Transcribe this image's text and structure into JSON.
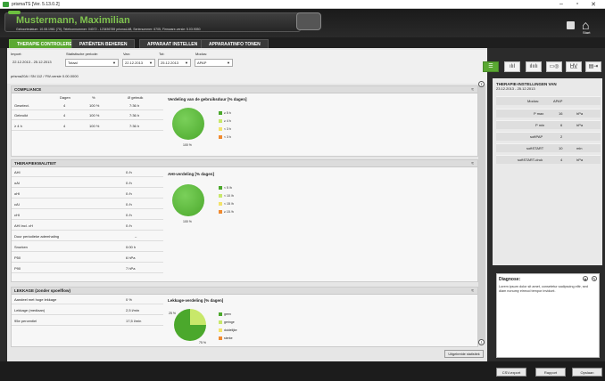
{
  "window": {
    "title": "prismaTS [Ver. 5.13.0.2]",
    "controls": [
      "–",
      "▫",
      "✕"
    ]
  },
  "patient": {
    "tag": "Meldung",
    "name": "Mustermann, Maximilian",
    "info": "Geboortedatum: 10.08.1961 (70), Telefoonnummer: 04072 - 123456789      prismaLAB, Serienummer: 6705, Firmware-versie: 5.03.9050"
  },
  "header": {
    "home_label": "Start"
  },
  "tabs": [
    "THERAPIE CONTROLEREN",
    "PATIËNTEN BEHEREN",
    "APPARAAT INSTELLEN",
    "APPARAATINFO TONEN"
  ],
  "filters": {
    "import_label": "Import:",
    "import_value": "22.12.2013 - 25.12.2013",
    "period_label": "Statistische periode:",
    "period_value": "Totaal",
    "from_label": "Van:",
    "from_value": "22.12.2013",
    "to_label": "Tot:",
    "to_value": "25.12.2013",
    "mode_label": "Modus:",
    "mode_value": "APAP",
    "fw": "prisma20A / SN 112 / FW-versie 0.00.0000"
  },
  "view_buttons": [
    "☰",
    "ılıl",
    "ılıılı",
    "▭◎",
    "H̲V̲",
    "▤⇥"
  ],
  "compliance": {
    "title": "COMPLIANCE",
    "headers": [
      "Dagen",
      "%",
      "Ø gebruik"
    ],
    "rows": [
      [
        "Geselect.",
        "4",
        "100 %",
        "7:36 h"
      ],
      [
        "Gebruikt",
        "4",
        "100 %",
        "7:36 h"
      ],
      [
        "≥ 4 h",
        "4",
        "100 %",
        "7:36 h"
      ]
    ],
    "chart_title": "Verdeling van de gebruiksduur [% dagen]",
    "pie_label": "100 %",
    "legend": [
      "≥ 5 h",
      "≥ 4 h",
      "< 3 h",
      "< 3 h"
    ]
  },
  "quality": {
    "title": "THERAPIEKWALITEIT",
    "rows": [
      [
        "AHI",
        "0 /h"
      ],
      [
        "oAI",
        "0 /h"
      ],
      [
        "oHI",
        "0 /h"
      ],
      [
        "cAI",
        "0 /h"
      ],
      [
        "cHI",
        "0 /h"
      ],
      [
        "AHI incl. cH",
        "0 /h"
      ],
      [
        "Duur periodieke ademhaling",
        "–"
      ],
      [
        "Snurken",
        "0:00 h"
      ],
      [
        "P50",
        "6 hPa"
      ],
      [
        "P90",
        "7 hPa"
      ]
    ],
    "chart_title": "AHI-verdeling [% dagen]",
    "pie_label": "100 %",
    "legend": [
      "< 5 /h",
      "< 10 /h",
      "< 15 /h",
      "≥ 15 /h"
    ]
  },
  "leak": {
    "title": "LEKKAGE (zonder spoelflow)",
    "rows": [
      [
        "Aandeel met hoge lekkage",
        "0 %"
      ],
      [
        "Lekkage (mediaan)",
        "2,5 l/min"
      ],
      [
        "95e percentiel",
        "17,5 l/min"
      ]
    ],
    "chart_title": "Lekkage-verdeling [% dagen]",
    "pie_label_a": "25 %",
    "pie_label_b": "75 %",
    "legend": [
      "geen",
      "geringe",
      "duidelijke",
      "sterke"
    ]
  },
  "stats_button": "Uitgebreide statistiek",
  "settings": {
    "title": "THERAPIE-INSTELLINGEN VAN",
    "subtitle": "23.12.2013 - 25.12.2013",
    "rows": [
      [
        "Modus:",
        "APAP",
        ""
      ],
      [
        "P max",
        "16",
        "hPa"
      ],
      [
        "P min",
        "6",
        "hPa"
      ],
      [
        "softPAP",
        "2",
        ""
      ],
      [
        "softSTART",
        "10",
        "min"
      ],
      [
        "softSTART-druk",
        "4",
        "hPa"
      ]
    ]
  },
  "diagnosis": {
    "title": "Diagnose:",
    "text": "Lorem ipsum dolor sit amet, consetetur sadipscing elitr, sed diam nonumy eirmod tempor invidunt."
  },
  "footer": {
    "buttons": [
      "CSV-export",
      "Rapport",
      "Opslaan"
    ]
  },
  "colors": {
    "accent": "#5aa832",
    "dark": "#4ba82c",
    "light": "#c8e86a",
    "yellow": "#f3e36a",
    "orange": "#f08a30"
  }
}
